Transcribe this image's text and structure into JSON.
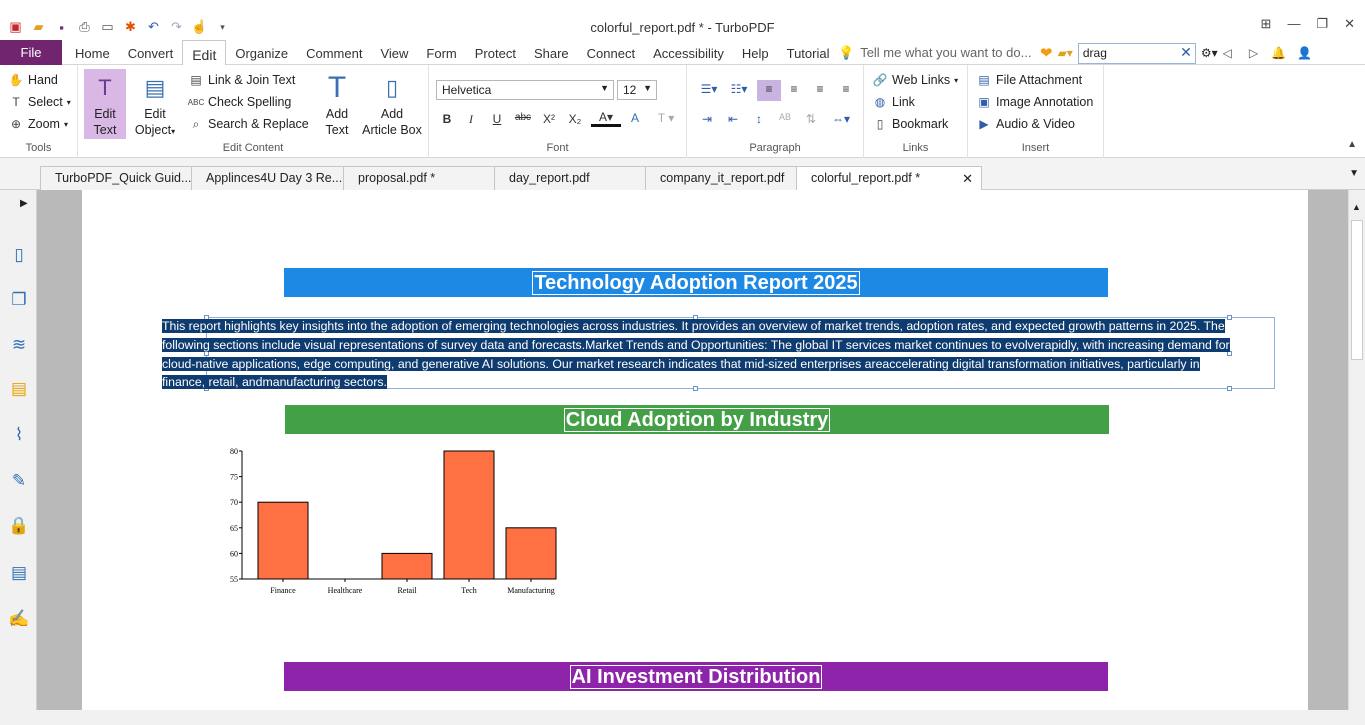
{
  "window": {
    "title": "colorful_report.pdf * - TurboPDF"
  },
  "menu": {
    "file": "File",
    "tabs": [
      "Home",
      "Convert",
      "Edit",
      "Organize",
      "Comment",
      "View",
      "Form",
      "Protect",
      "Share",
      "Connect",
      "Accessibility",
      "Help",
      "Tutorial"
    ],
    "active": "Edit",
    "tell_me": "Tell me what you want to do...",
    "search_value": "drag"
  },
  "ribbon": {
    "tools": {
      "label": "Tools",
      "hand": "Hand",
      "select": "Select",
      "zoom": "Zoom"
    },
    "edit_content": {
      "label": "Edit Content",
      "edit_text_1": "Edit",
      "edit_text_2": "Text",
      "edit_object_1": "Edit",
      "edit_object_2": "Object",
      "link_join": "Link & Join Text",
      "check_spelling": "Check Spelling",
      "search_replace": "Search & Replace",
      "add_text_1": "Add",
      "add_text_2": "Text",
      "add_article_1": "Add",
      "add_article_2": "Article Box"
    },
    "font": {
      "label": "Font",
      "family": "Helvetica",
      "size": "12"
    },
    "paragraph": {
      "label": "Paragraph"
    },
    "links": {
      "label": "Links",
      "web_links": "Web Links",
      "link": "Link",
      "bookmark": "Bookmark"
    },
    "insert": {
      "label": "Insert",
      "file_attachment": "File Attachment",
      "image_annotation": "Image Annotation",
      "audio_video": "Audio & Video"
    }
  },
  "doc_tabs": [
    "TurboPDF_Quick Guid...",
    "Applinces4U Day 3 Re...",
    "proposal.pdf *",
    "day_report.pdf",
    "company_it_report.pdf",
    "colorful_report.pdf *"
  ],
  "document": {
    "title": "Technology Adoption Report 2025",
    "paragraph": "This report highlights key insights into the adoption of emerging technologies across industries. It provides an overview of market trends, adoption rates, and expected growth patterns in 2025. The following sections include visual representations of survey data and forecasts.Market Trends and Opportunities: The global IT services market continues to evolverapidly, with increasing demand for cloud-native applications, edge computing, and generative AI solutions. Our market research indicates that mid-sized enterprises areaccelerating digital transformation initiatives, particularly in finance, retail, andmanufacturing sectors.",
    "section1": "Cloud Adoption by Industry",
    "section2": "AI Investment Distribution"
  },
  "colors": {
    "title_banner": "#1e88e5",
    "section1_banner": "#43a047",
    "section2_banner": "#8e24aa",
    "bar": "#ff7043",
    "file_btn": "#71256f"
  },
  "chart_data": {
    "type": "bar",
    "categories": [
      "Finance",
      "Healthcare",
      "Retail",
      "Tech",
      "Manufacturing"
    ],
    "values": [
      70,
      55,
      60,
      80,
      65
    ],
    "ytick_labels": [
      "80",
      "75",
      "70",
      "65",
      "60",
      "55"
    ],
    "ylim": [
      55,
      80
    ]
  }
}
